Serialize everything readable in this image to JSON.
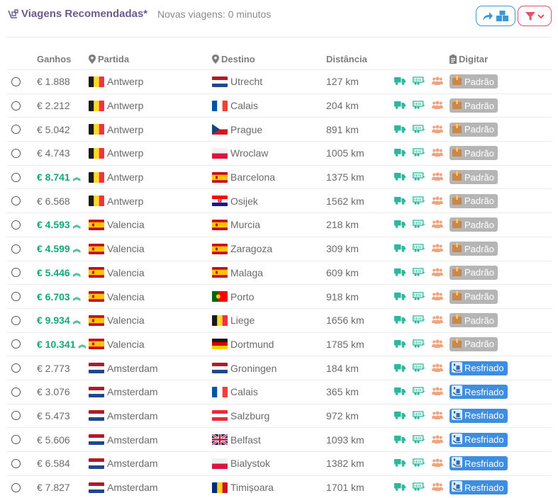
{
  "header": {
    "title": "Viagens Recomendadas*",
    "subtitle": "Novas viagens: 0 minutos"
  },
  "columns": {
    "earnings": "Ganhos",
    "origin": "Partida",
    "destination": "Destino",
    "distance": "Distância",
    "type": "Digitar"
  },
  "colors": {
    "accent": "#6b5a8e",
    "positive": "#17a57a",
    "share_button": "#3a9ad9",
    "filter_button": "#e05366",
    "padrao_badge": "#b5b5b5",
    "resfriado_badge": "#3d8ee0"
  },
  "rows": [
    {
      "earnings": "€ 1.888",
      "highlight": false,
      "origin": "Antwerp",
      "origin_flag": "be",
      "destination": "Utrecht",
      "dest_flag": "nl",
      "distance": "127 km",
      "cargo": "Padrão"
    },
    {
      "earnings": "€ 2.212",
      "highlight": false,
      "origin": "Antwerp",
      "origin_flag": "be",
      "destination": "Calais",
      "dest_flag": "fr",
      "distance": "204 km",
      "cargo": "Padrão"
    },
    {
      "earnings": "€ 5.042",
      "highlight": false,
      "origin": "Antwerp",
      "origin_flag": "be",
      "destination": "Prague",
      "dest_flag": "cz",
      "distance": "891 km",
      "cargo": "Padrão"
    },
    {
      "earnings": "€ 4.743",
      "highlight": false,
      "origin": "Antwerp",
      "origin_flag": "be",
      "destination": "Wroclaw",
      "dest_flag": "pl",
      "distance": "1005 km",
      "cargo": "Padrão"
    },
    {
      "earnings": "€ 8.741",
      "highlight": true,
      "origin": "Antwerp",
      "origin_flag": "be",
      "destination": "Barcelona",
      "dest_flag": "es",
      "distance": "1375 km",
      "cargo": "Padrão"
    },
    {
      "earnings": "€ 6.568",
      "highlight": false,
      "origin": "Antwerp",
      "origin_flag": "be",
      "destination": "Osijek",
      "dest_flag": "hr",
      "distance": "1562 km",
      "cargo": "Padrão"
    },
    {
      "earnings": "€ 4.593",
      "highlight": true,
      "origin": "Valencia",
      "origin_flag": "es",
      "destination": "Murcia",
      "dest_flag": "es",
      "distance": "218 km",
      "cargo": "Padrão"
    },
    {
      "earnings": "€ 4.599",
      "highlight": true,
      "origin": "Valencia",
      "origin_flag": "es",
      "destination": "Zaragoza",
      "dest_flag": "es",
      "distance": "309 km",
      "cargo": "Padrão"
    },
    {
      "earnings": "€ 5.446",
      "highlight": true,
      "origin": "Valencia",
      "origin_flag": "es",
      "destination": "Malaga",
      "dest_flag": "es",
      "distance": "609 km",
      "cargo": "Padrão"
    },
    {
      "earnings": "€ 6.703",
      "highlight": true,
      "origin": "Valencia",
      "origin_flag": "es",
      "destination": "Porto",
      "dest_flag": "pt",
      "distance": "918 km",
      "cargo": "Padrão"
    },
    {
      "earnings": "€ 9.934",
      "highlight": true,
      "origin": "Valencia",
      "origin_flag": "es",
      "destination": "Liege",
      "dest_flag": "be",
      "distance": "1656 km",
      "cargo": "Padrão"
    },
    {
      "earnings": "€ 10.341",
      "highlight": true,
      "origin": "Valencia",
      "origin_flag": "es",
      "destination": "Dortmund",
      "dest_flag": "de",
      "distance": "1785 km",
      "cargo": "Padrão"
    },
    {
      "earnings": "€ 2.773",
      "highlight": false,
      "origin": "Amsterdam",
      "origin_flag": "nl",
      "destination": "Groningen",
      "dest_flag": "nl",
      "distance": "184 km",
      "cargo": "Resfriado"
    },
    {
      "earnings": "€ 3.076",
      "highlight": false,
      "origin": "Amsterdam",
      "origin_flag": "nl",
      "destination": "Calais",
      "dest_flag": "fr",
      "distance": "365 km",
      "cargo": "Resfriado"
    },
    {
      "earnings": "€ 5.473",
      "highlight": false,
      "origin": "Amsterdam",
      "origin_flag": "nl",
      "destination": "Salzburg",
      "dest_flag": "at",
      "distance": "972 km",
      "cargo": "Resfriado"
    },
    {
      "earnings": "€ 5.606",
      "highlight": false,
      "origin": "Amsterdam",
      "origin_flag": "nl",
      "destination": "Belfast",
      "dest_flag": "gb",
      "distance": "1093 km",
      "cargo": "Resfriado"
    },
    {
      "earnings": "€ 6.584",
      "highlight": false,
      "origin": "Amsterdam",
      "origin_flag": "nl",
      "destination": "Bialystok",
      "dest_flag": "pl",
      "distance": "1382 km",
      "cargo": "Resfriado"
    },
    {
      "earnings": "€ 7.827",
      "highlight": false,
      "origin": "Amsterdam",
      "origin_flag": "nl",
      "destination": "Timișoara",
      "dest_flag": "ro",
      "distance": "1701 km",
      "cargo": "Resfriado"
    }
  ]
}
